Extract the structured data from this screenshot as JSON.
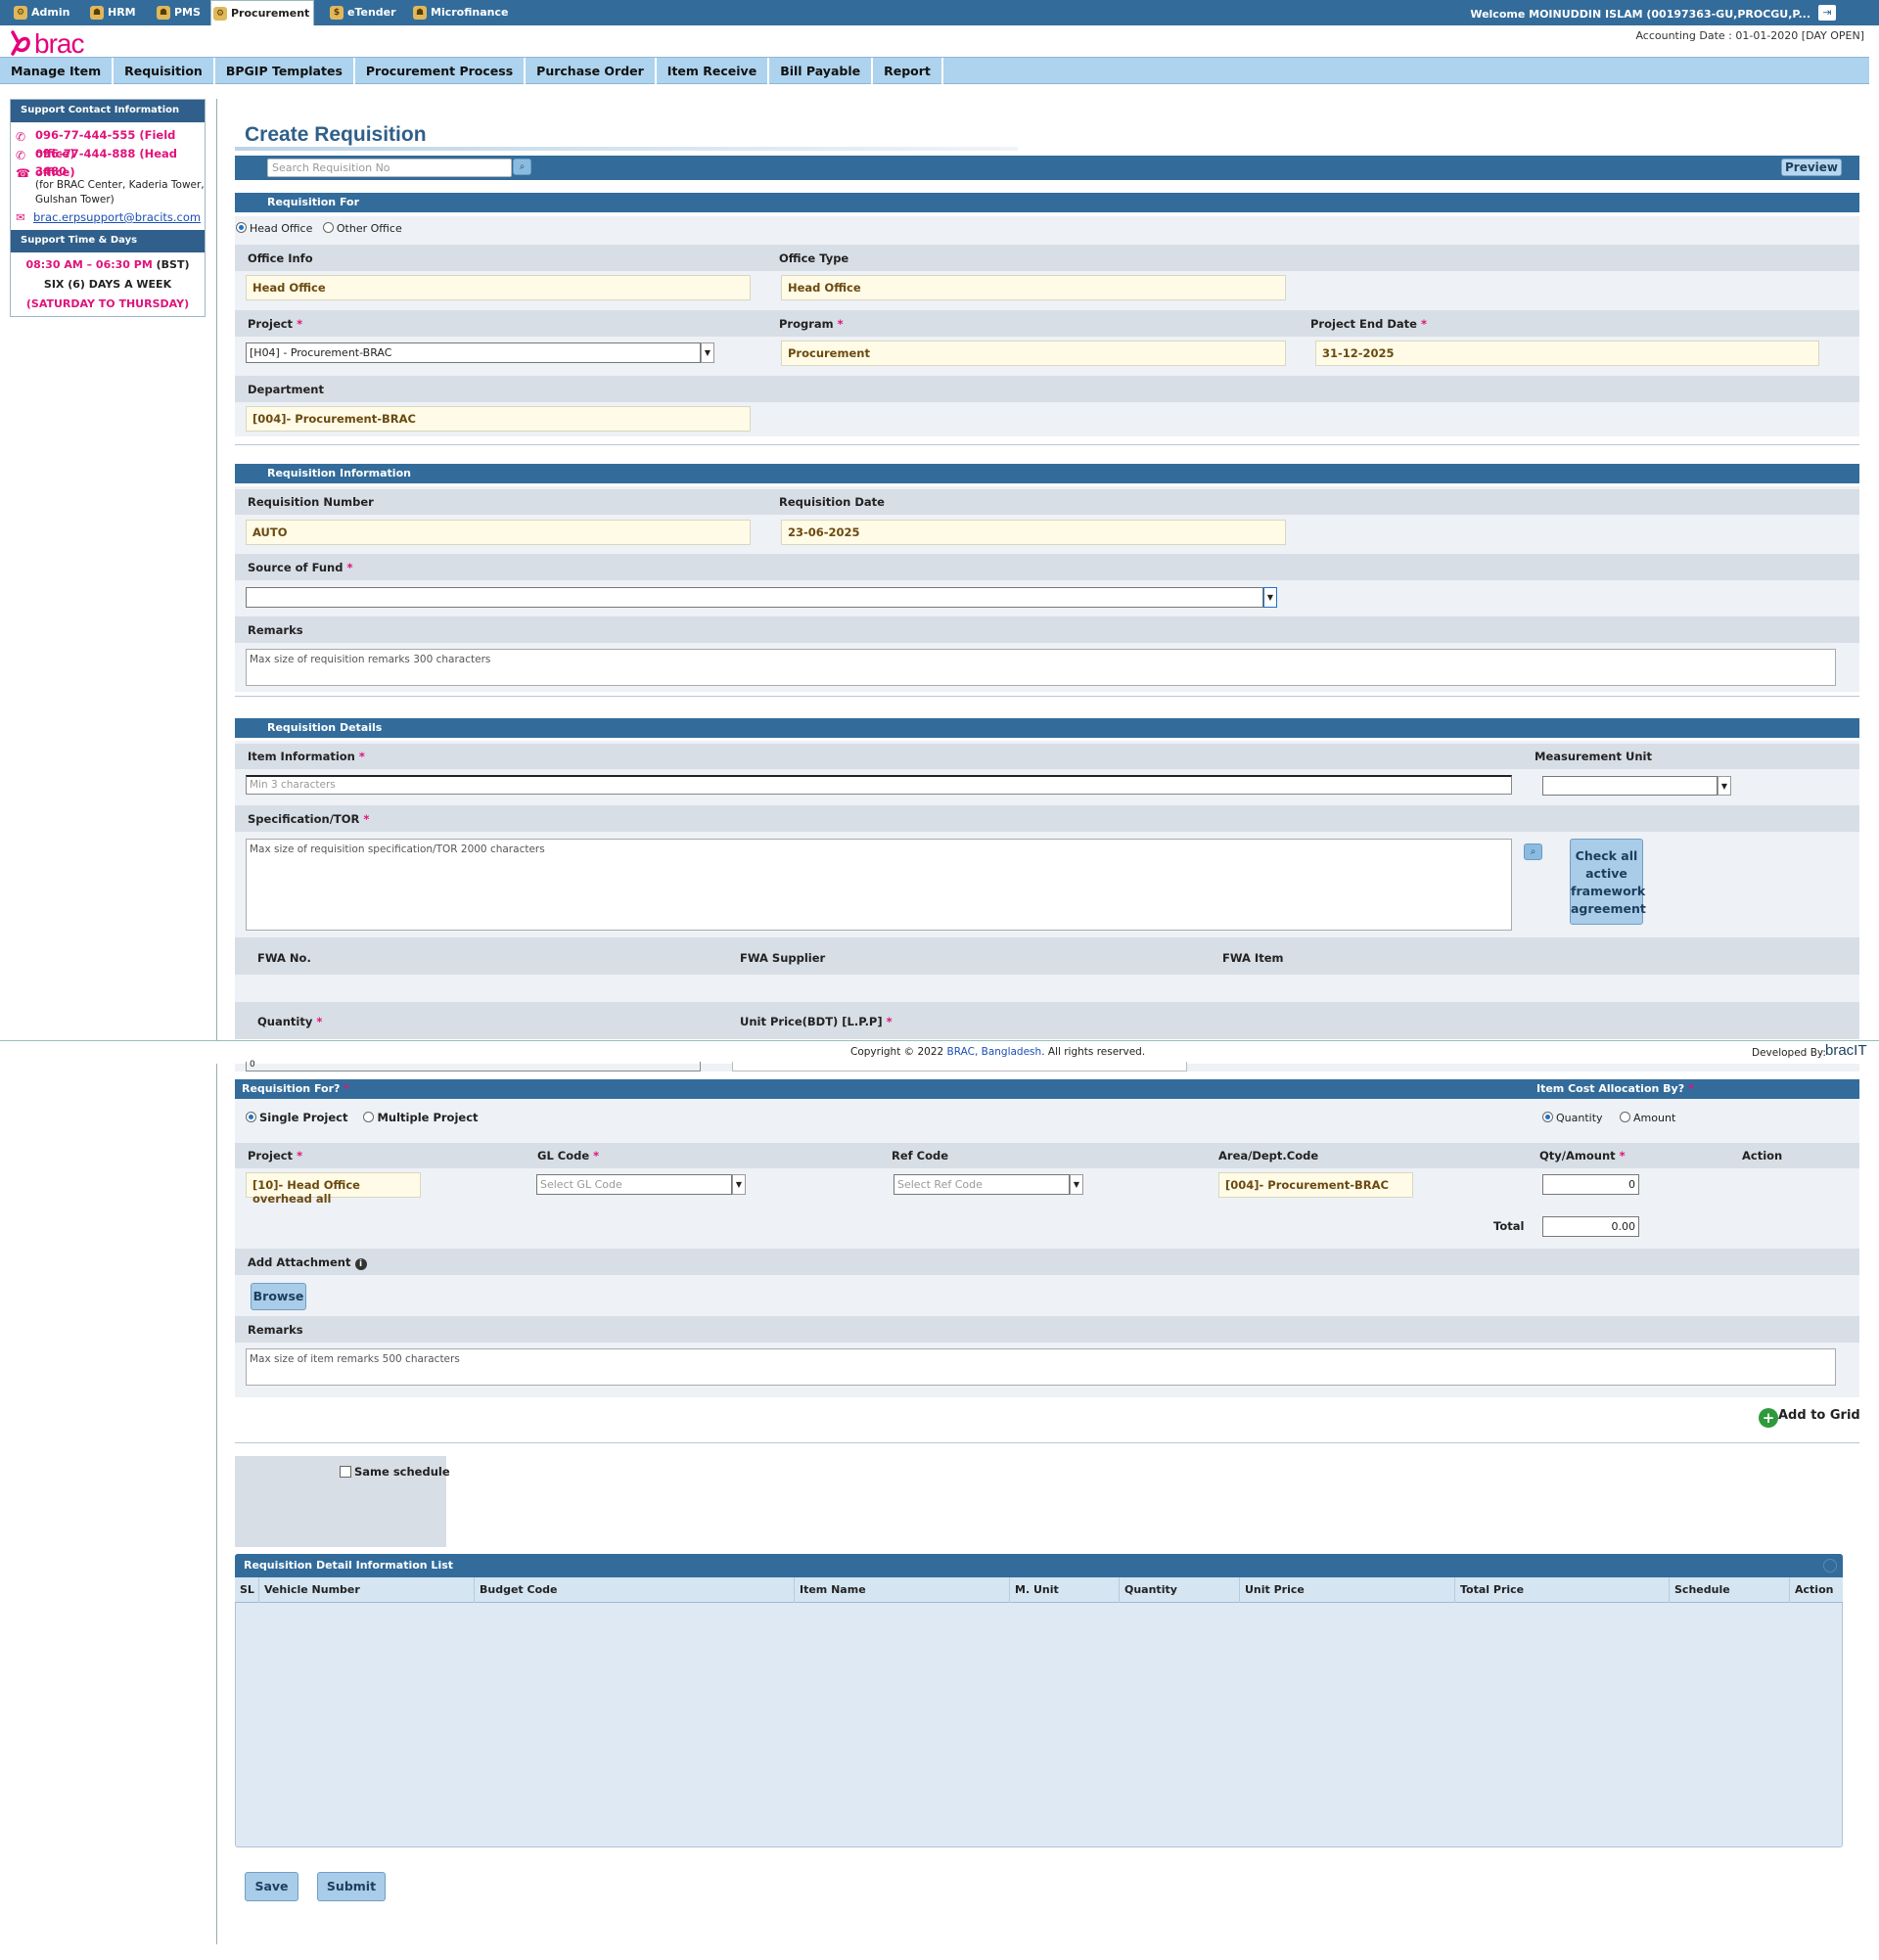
{
  "topbar": {
    "modules": [
      {
        "label": "Admin",
        "icon": "gear-people-icon"
      },
      {
        "label": "HRM",
        "icon": "people-icon"
      },
      {
        "label": "PMS",
        "icon": "people-icon"
      },
      {
        "label": "Procurement",
        "icon": "gear-icon"
      },
      {
        "label": "eTender",
        "icon": "money-bag-icon"
      },
      {
        "label": "Microfinance",
        "icon": "people-icon"
      }
    ],
    "welcome": "Welcome MOINUDDIN ISLAM (00197363-GU,PROCGU,P...",
    "accounting_date": "Accounting Date : 01-01-2020 [DAY OPEN]"
  },
  "logo_text": "brac",
  "menu": [
    "Manage Item",
    "Requisition",
    "BPGIP Templates",
    "Procurement Process",
    "Purchase Order",
    "Item Receive",
    "Bill Payable",
    "Report"
  ],
  "support": {
    "contact_header": "Support Contact Information",
    "phone_field": "096-77-444-555 (Field office)",
    "phone_head": "096-77-444-888 (Head office)",
    "ext": "3480",
    "ext_note": "(for BRAC Center, Kaderia Tower, Gulshan Tower)",
    "email": "brac.erpsupport@bracits.com",
    "time_header": "Support Time & Days",
    "hours_time": "08:30 AM – 06:30 PM",
    "hours_zone": "(BST)",
    "days": "SIX (6) DAYS A WEEK",
    "days_range": "(SATURDAY TO THURSDAY)"
  },
  "page_title": "Create Requisition",
  "search": {
    "placeholder": "Search Requisition No"
  },
  "preview_label": "Preview",
  "req_for": {
    "section": "Requisition For",
    "head_office": "Head Office",
    "other_office": "Other Office",
    "office_info_label": "Office Info",
    "office_info_value": "Head Office",
    "office_type_label": "Office Type",
    "office_type_value": "Head Office",
    "project_label": "Project",
    "project_value": "[H04] - Procurement-BRAC",
    "program_label": "Program",
    "program_value": "Procurement",
    "end_date_label": "Project End Date",
    "end_date_value": "31-12-2025",
    "department_label": "Department",
    "department_value": "[004]- Procurement-BRAC"
  },
  "req_info": {
    "section": "Requisition Information",
    "number_label": "Requisition Number",
    "number_value": "AUTO",
    "date_label": "Requisition Date",
    "date_value": "23-06-2025",
    "fund_label": "Source of Fund",
    "remarks_label": "Remarks",
    "remarks_placeholder": "Max size of requisition remarks 300 characters"
  },
  "req_details": {
    "section": "Requisition Details",
    "item_label": "Item Information",
    "item_placeholder": "Min 3 characters",
    "unit_label": "Measurement Unit",
    "spec_label": "Specification/TOR",
    "spec_placeholder": "Max size of requisition specification/TOR 2000 characters",
    "fwa_button": "Check all active framework agreement",
    "fwa_no": "FWA No.",
    "fwa_supplier": "FWA Supplier",
    "fwa_item": "FWA Item",
    "quantity_label": "Quantity",
    "unit_price_label": "Unit Price(BDT) [L.P.P]"
  },
  "footer": {
    "copyright_pre": "Copyright © 2022 ",
    "copyright_link": "BRAC, Bangladesh",
    "copyright_post": ". All rights reserved.",
    "developed_by": "Developed By:",
    "dev_logo": "bracIT"
  },
  "allocation": {
    "partial_value": "0",
    "req_for_label": "Requisition For?",
    "cost_by_label": "Item Cost Allocation By?",
    "single": "Single Project",
    "multiple": "Multiple Project",
    "by_quantity": "Quantity",
    "by_amount": "Amount",
    "col_project": "Project",
    "col_gl": "GL Code",
    "col_ref": "Ref Code",
    "col_area": "Area/Dept.Code",
    "col_qty": "Qty/Amount",
    "col_action": "Action",
    "project_value": "[10]- Head Office overhead all",
    "gl_placeholder": "Select GL Code",
    "ref_placeholder": "Select Ref Code",
    "area_value": "[004]- Procurement-BRAC",
    "qty_value": "0",
    "total_label": "Total",
    "total_value": "0.00",
    "attachment_label": "Add Attachment",
    "browse_label": "Browse",
    "remarks_label": "Remarks",
    "remarks_placeholder": "Max size of item remarks 500 characters",
    "add_to_grid": "Add to Grid",
    "same_schedule": "Same schedule"
  },
  "grid": {
    "title": "Requisition Detail Information List",
    "columns": [
      "SL",
      "Vehicle Number",
      "Budget Code",
      "Item Name",
      "M. Unit",
      "Quantity",
      "Unit Price",
      "Total Price",
      "Schedule",
      "Action"
    ]
  },
  "actions": {
    "save": "Save",
    "submit": "Submit"
  }
}
